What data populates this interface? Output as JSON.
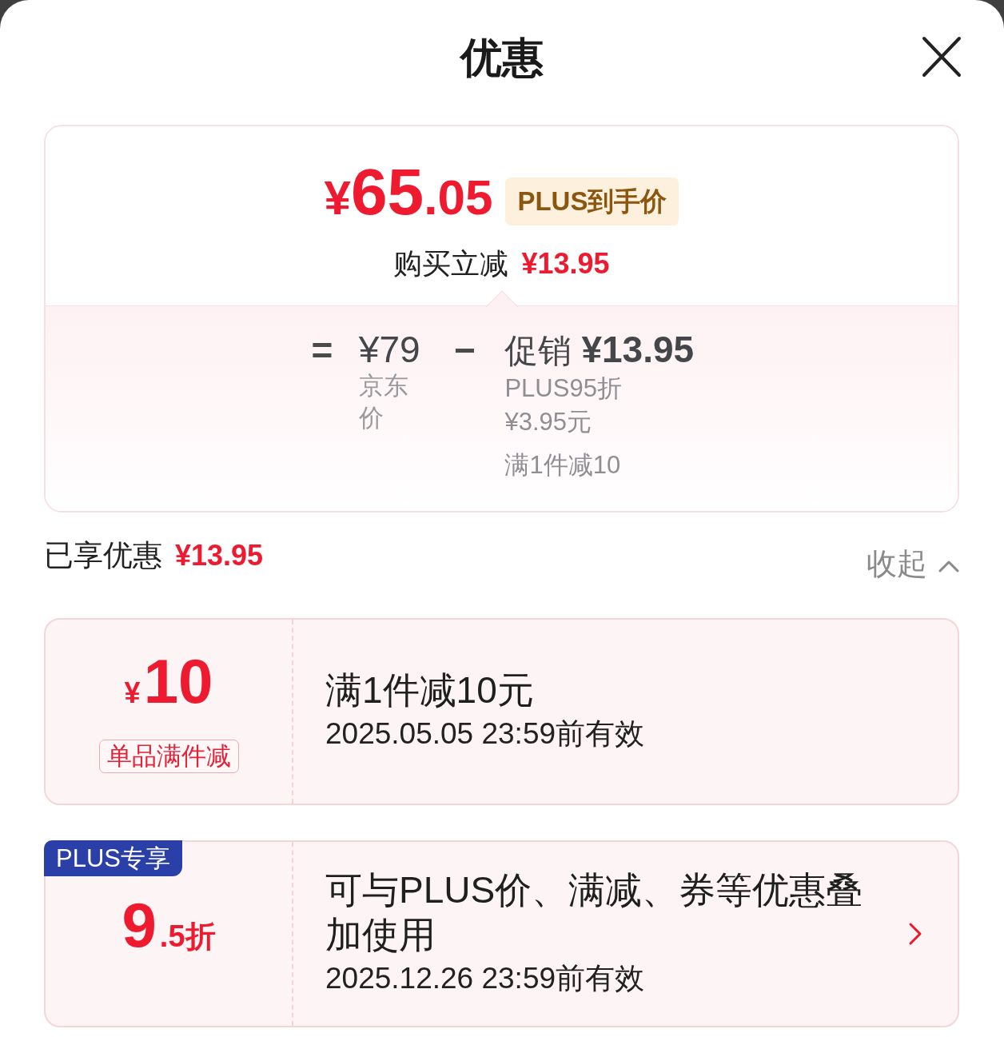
{
  "header": {
    "title": "优惠"
  },
  "summary": {
    "price": {
      "currency": "¥",
      "integer": "65",
      "decimal": ".05"
    },
    "badge": "PLUS到手价",
    "saving": {
      "label": "购买立减",
      "amount": "¥13.95"
    },
    "breakdown": {
      "equals": "=",
      "base": {
        "amount": "¥79",
        "label": "京东价"
      },
      "minus": "−",
      "promo": {
        "label": "促销",
        "amount": "¥13.95",
        "details": [
          {
            "label": "PLUS95折",
            "amount": "¥3.95元"
          },
          {
            "label": "满1件减10"
          }
        ]
      }
    }
  },
  "enjoyed": {
    "label": "已享优惠",
    "amount": "¥13.95",
    "toggle": "收起",
    "expanded": true
  },
  "coupons": [
    {
      "kind": "amount",
      "currency": "¥",
      "value": "10",
      "tag": "单品满件减",
      "title": "满1件减10元",
      "validity": "2025.05.05 23:59前有效",
      "has_arrow": false
    },
    {
      "kind": "discount",
      "badge": "PLUS专享",
      "value": "9",
      "suffix": ".5折",
      "title": "可与PLUS价、满减、券等优惠叠加使用",
      "validity": "2025.12.26 23:59前有效",
      "has_arrow": true
    }
  ]
}
